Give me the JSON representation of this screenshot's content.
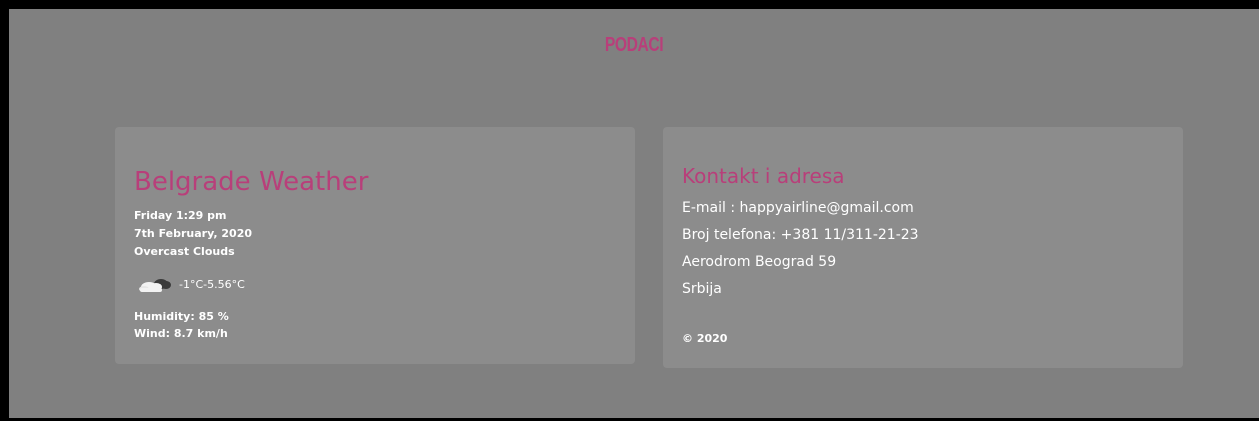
{
  "colors": {
    "accent": "#b83f7a",
    "background": "#808080",
    "card": "#8c8c8c",
    "text": "#ffffff"
  },
  "header": {
    "title": "PODACI"
  },
  "weather": {
    "title": "Belgrade Weather",
    "day_time": "Friday 1:29 pm",
    "date": "7th February, 2020",
    "condition": "Overcast Clouds",
    "icon": "overcast-clouds-icon",
    "temperature": "-1°C-5.56°C",
    "humidity": "Humidity: 85 %",
    "wind": "Wind: 8.7 km/h"
  },
  "contact": {
    "title": "Kontakt i adresa",
    "email": "E-mail : happyairline@gmail.com",
    "phone": "Broj telefona: +381 11/311-21-23",
    "address": "Aerodrom Beograd 59",
    "country": "Srbija",
    "copyright": "© 2020"
  }
}
